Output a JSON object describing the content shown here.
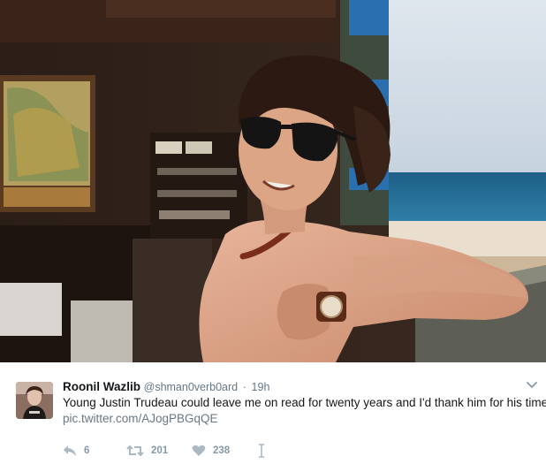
{
  "tweet": {
    "display_name": "Roonil Wazlib",
    "handle": "@shman0verb0ard",
    "separator": "·",
    "time": "19h",
    "text": "Young Justin Trudeau could leave me on read for twenty years and I'd thank him for his time.",
    "link": "pic.twitter.com/AJogPBGqQE"
  },
  "actions": {
    "reply_count": "6",
    "retweet_count": "201",
    "like_count": "238"
  },
  "icons": {
    "reply": "reply-icon",
    "retweet": "retweet-icon",
    "like": "heart-icon",
    "more": "more-icon",
    "caret": "chevron-down-icon"
  },
  "colors": {
    "name": "#14171a",
    "meta": "#657786",
    "link": "#697882",
    "action": "#8899a6"
  }
}
